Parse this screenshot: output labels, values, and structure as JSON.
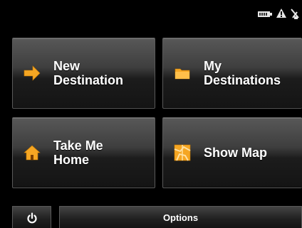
{
  "status_bar": {
    "icons": [
      "battery-icon",
      "warning-icon",
      "satellite-icon"
    ]
  },
  "menu": {
    "tiles": [
      {
        "id": "new-destination",
        "label": "New\nDestination",
        "icon": "arrow-right-icon"
      },
      {
        "id": "my-destinations",
        "label": "My\nDestinations",
        "icon": "folder-icon"
      },
      {
        "id": "take-me-home",
        "label": "Take Me\nHome",
        "icon": "home-icon"
      },
      {
        "id": "show-map",
        "label": "Show Map",
        "icon": "map-icon"
      }
    ]
  },
  "bottom_bar": {
    "power_icon": "power-icon",
    "options_label": "Options"
  },
  "colors": {
    "icon_orange": "#f5a623",
    "text": "#ffffff",
    "background": "#000000"
  }
}
